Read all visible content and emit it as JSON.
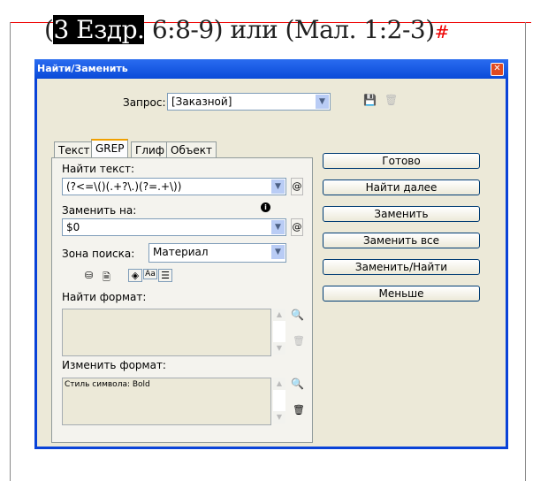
{
  "document": {
    "selected_text": "3 Ездр.",
    "rest_text": " 6:8-9) или (Мал. 1:2-3)",
    "open_paren": "(",
    "end_marker": "#"
  },
  "dialog": {
    "title": "Найти/Заменить",
    "query_label": "Запрос:",
    "query_value": "[Заказной]",
    "tabs": [
      "Текст",
      "GREP",
      "Глиф",
      "Объект"
    ],
    "active_tab": "GREP",
    "find_label": "Найти текст:",
    "find_value": "(?<=\\()(.+?\\.)(?=.+\\))",
    "replace_label": "Заменить на:",
    "replace_value": "$0",
    "scope_label": "Зона поиска:",
    "scope_value": "Материал",
    "find_format_label": "Найти формат:",
    "find_format_value": "",
    "change_format_label": "Изменить формат:",
    "change_format_value": "Стиль символа: Bold",
    "buttons": [
      "Готово",
      "Найти далее",
      "Заменить",
      "Заменить все",
      "Заменить/Найти",
      "Меньше"
    ]
  }
}
